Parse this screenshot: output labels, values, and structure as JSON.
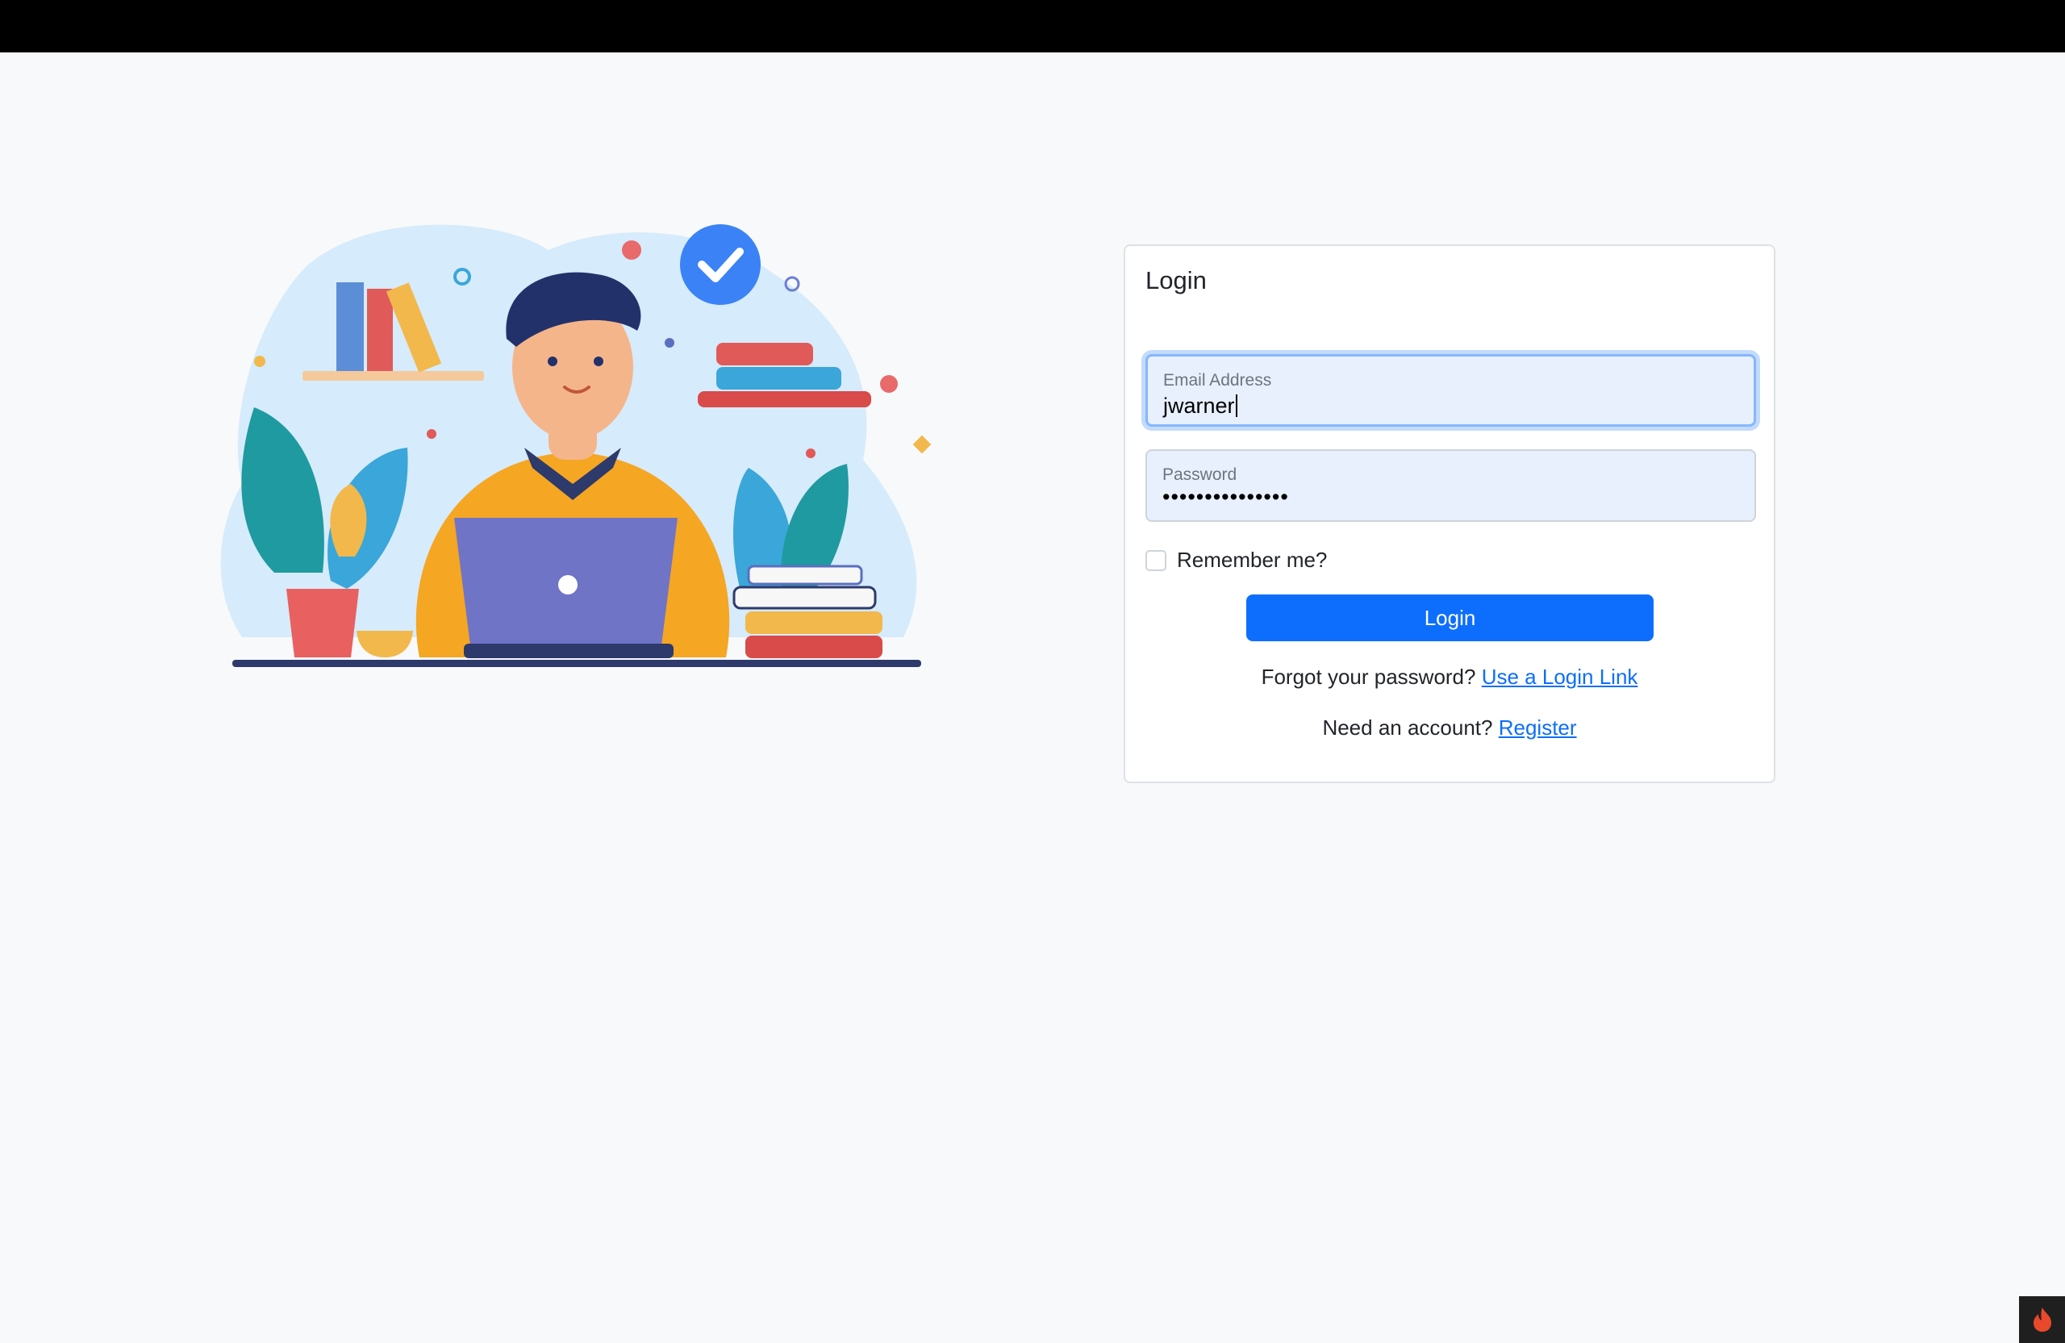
{
  "login_card": {
    "title": "Login",
    "email": {
      "label": "Email Address",
      "value": "jwarner"
    },
    "password": {
      "label": "Password",
      "value": "•••••••••••••••"
    },
    "remember_label": "Remember me?",
    "login_button": "Login",
    "forgot_text": "Forgot your password?",
    "forgot_link": "Use a Login Link",
    "account_text": "Need an account?",
    "register_link": "Register"
  },
  "icons": {
    "illustration": "person-with-laptop-illustration",
    "corner": "flame-icon"
  },
  "colors": {
    "primary": "#0d6efd",
    "focus_ring": "#86b7fe",
    "input_fill": "#e8f0fe",
    "flame": "#e8482c"
  }
}
